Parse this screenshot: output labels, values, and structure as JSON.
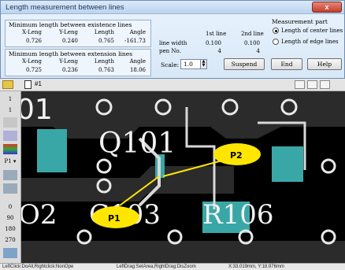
{
  "window": {
    "title": "Length measurement between lines",
    "close_label": "x"
  },
  "existence": {
    "title": "Minimum length between existence lines",
    "headers": [
      "X-Leng",
      "Y-Leng",
      "Length",
      "Angle"
    ],
    "values": [
      "0.726",
      "0.240",
      "0.765",
      "-161.73"
    ]
  },
  "extension": {
    "title": "Minimum length between extension lines",
    "headers": [
      "X-Leng",
      "Y-Leng",
      "Length",
      "Angle"
    ],
    "values": [
      "0.725",
      "0.236",
      "0.763",
      "18.06"
    ]
  },
  "lines": {
    "col1": "1st line",
    "col2": "2nd line",
    "row1_label": "line width",
    "row1_vals": [
      "0.100",
      "0.100"
    ],
    "row2_label": "pen No.",
    "row2_vals": [
      "4",
      "4"
    ]
  },
  "scale": {
    "label": "Scale:",
    "value": "1.0"
  },
  "buttons": {
    "suspend": "Suspend",
    "end": "End",
    "help": "Help"
  },
  "measurement_part": {
    "title": "Measurement part",
    "options": [
      "Length of center lines",
      "Length of edge lines"
    ],
    "selected": 0
  },
  "doc": {
    "tab": "#1"
  },
  "side_tools": {
    "labels": [
      "1",
      "1",
      "P1 ▾",
      "0",
      "90",
      "180",
      "270"
    ]
  },
  "board": {
    "labels": [
      "Q101",
      "O2",
      "C103",
      "R106",
      "01"
    ],
    "callouts": [
      "P1",
      "P2"
    ],
    "colors": {
      "copper": "#e8e8e8",
      "ground": "#2b2b2b",
      "slot": "#3aa7a7",
      "callout": "#ffe600"
    }
  },
  "status": {
    "left": "LeftClick:DoAll,Rightclick:NonOpe",
    "middle": "LeftDrag:SetArea,RightDrag:DisZoom",
    "coords": "X:33.019mm, Y:18.976mm"
  }
}
